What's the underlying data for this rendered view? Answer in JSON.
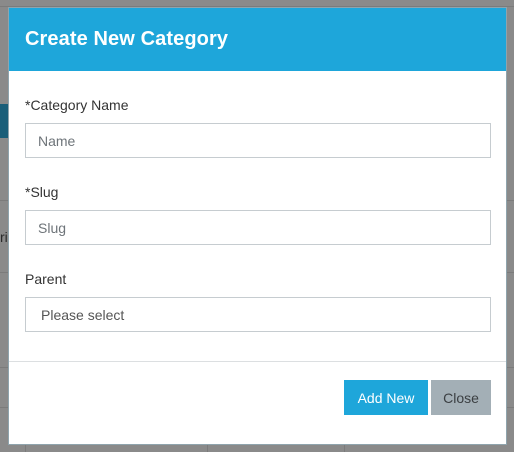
{
  "modal": {
    "title": "Create New Category",
    "fields": {
      "category_name": {
        "label": "*Category Name",
        "placeholder": "Name"
      },
      "slug": {
        "label": "*Slug",
        "placeholder": "Slug"
      },
      "parent": {
        "label": "Parent",
        "selected": "Please select"
      }
    },
    "buttons": {
      "add_new": "Add New",
      "close": "Close"
    }
  },
  "background": {
    "partial_text": "ri"
  },
  "colors": {
    "header": "#1ea6da",
    "primary_button": "#1ea6da",
    "secondary_button": "#a3afb6",
    "overlay": "#8a8a8a"
  }
}
